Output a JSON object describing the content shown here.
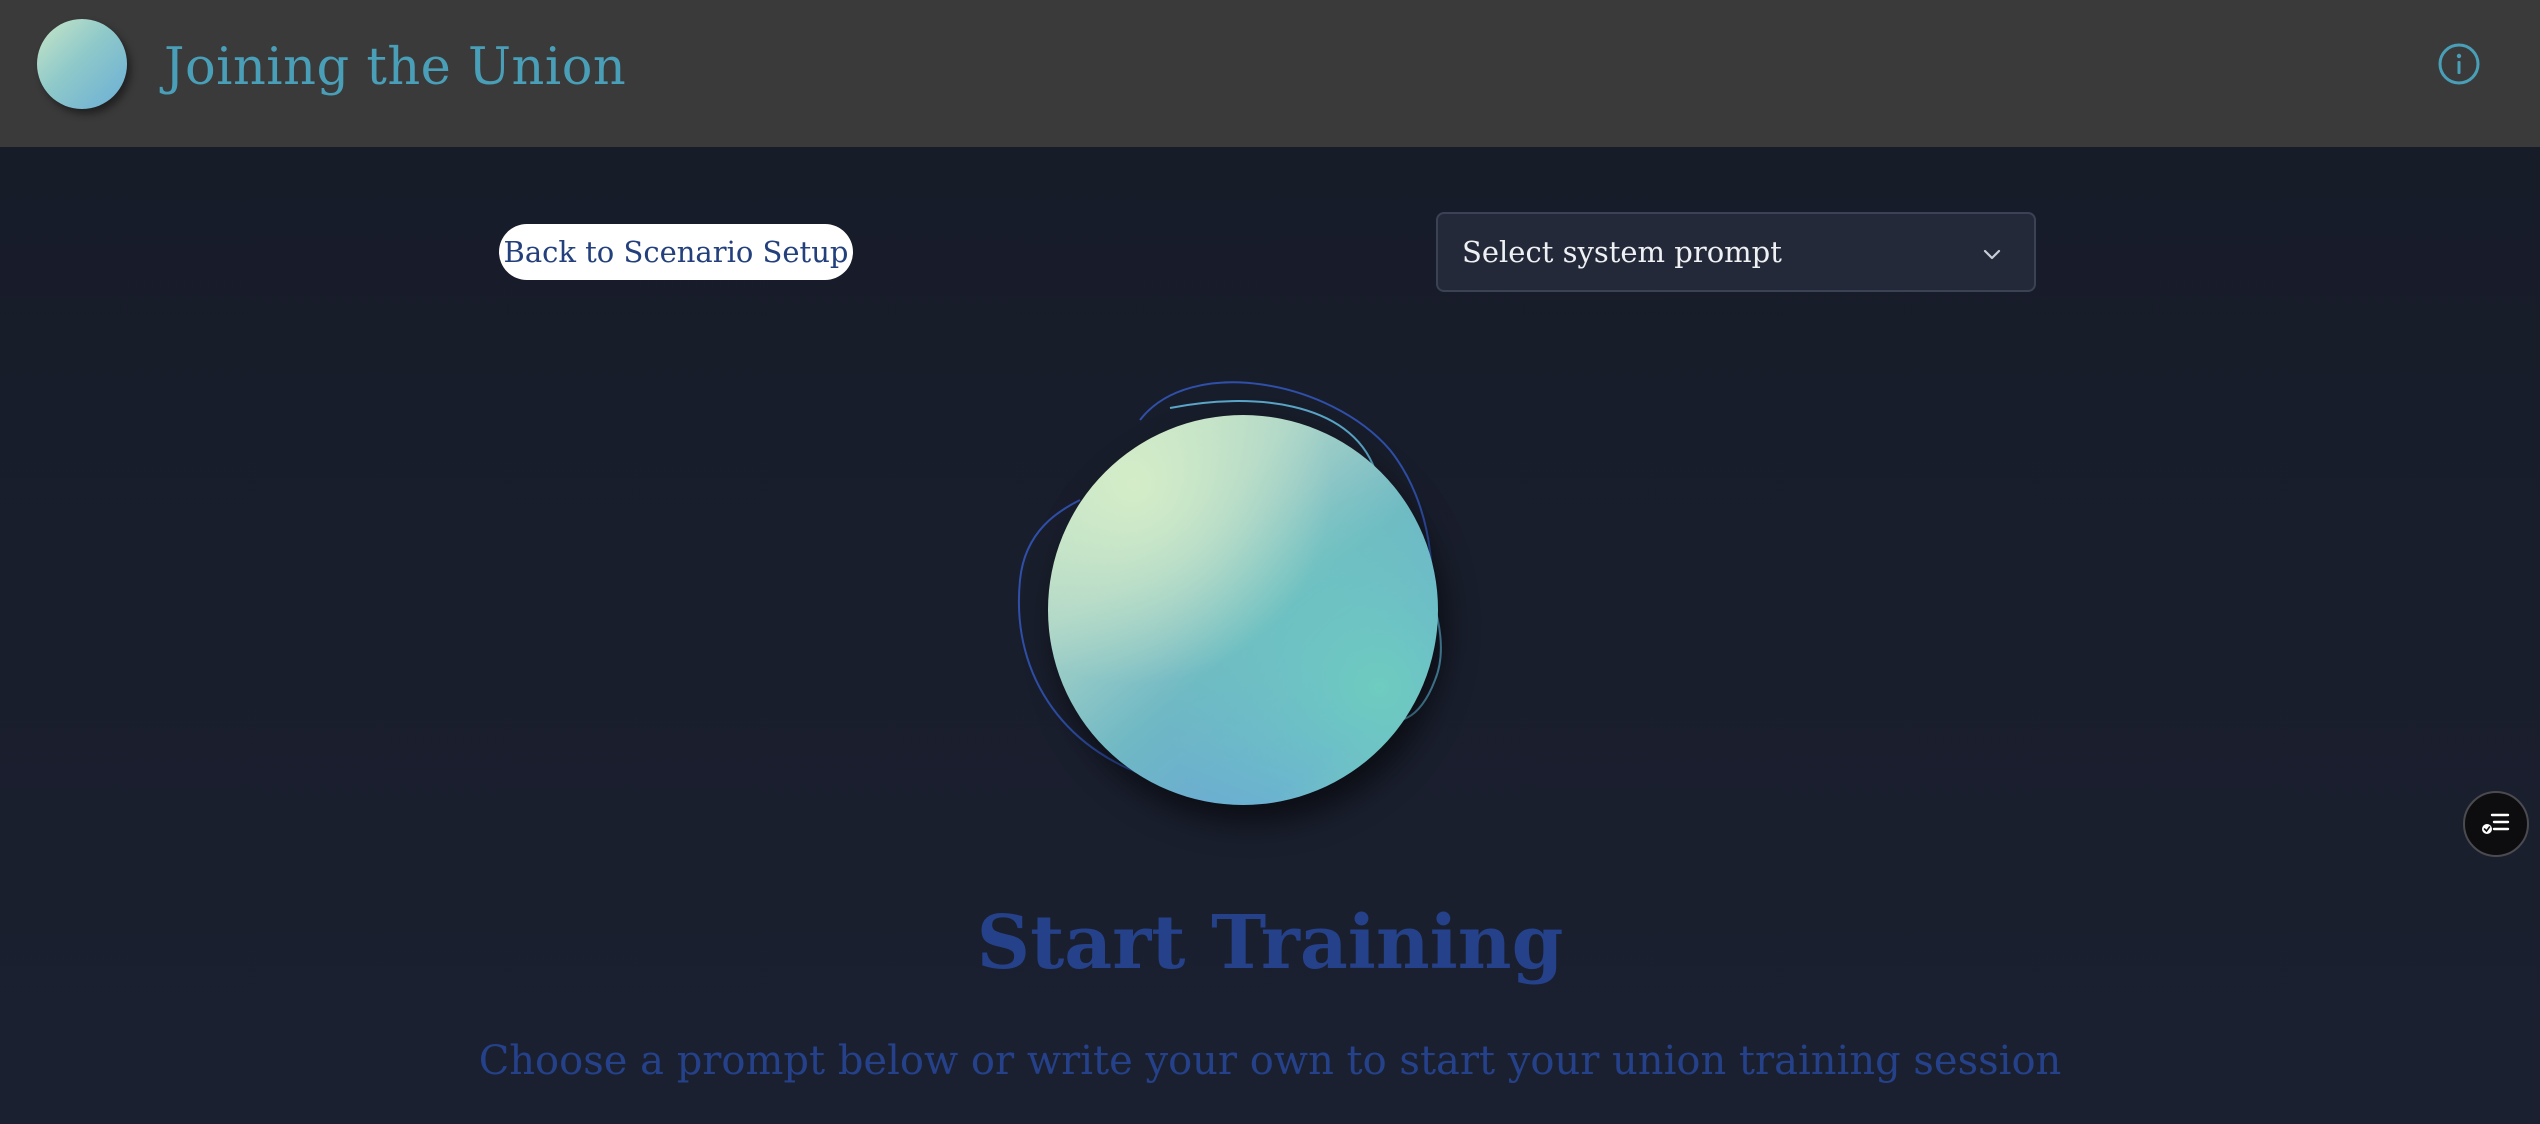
{
  "header": {
    "title": "Joining the Union",
    "info_icon": "info-circle-icon"
  },
  "toolbar": {
    "back_label": "Back to Scenario Setup",
    "select_label": "Select system prompt",
    "select_icon": "chevron-down-icon"
  },
  "hero": {
    "heading": "Start Training",
    "subheading": "Choose a prompt below or write your own to start your union training session"
  },
  "floating": {
    "icon": "list-menu-icon"
  },
  "colors": {
    "header_bg": "#3a3a3b",
    "page_bg": "#181d2b",
    "title_accent": "#4a9fb8",
    "heading_blue": "#24418a"
  }
}
